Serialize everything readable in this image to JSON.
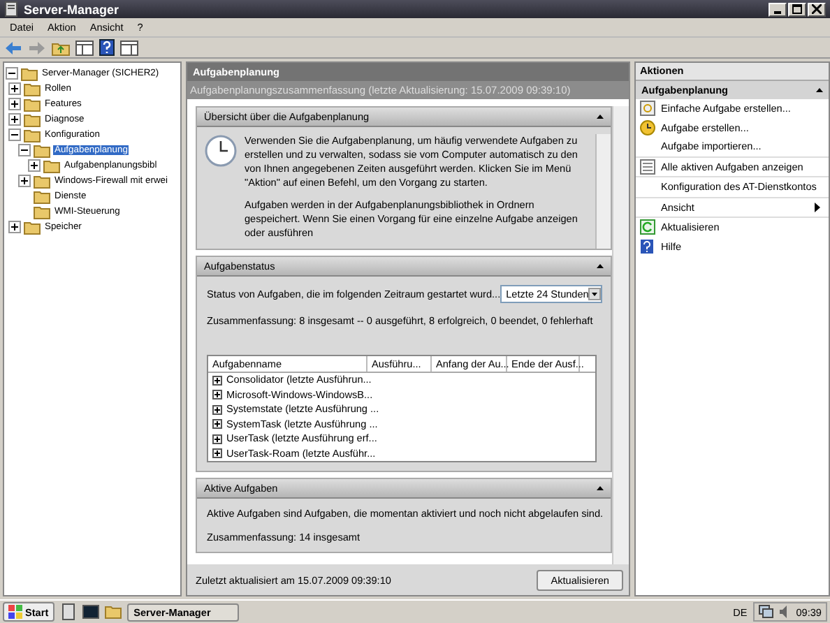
{
  "window": {
    "title": "Server-Manager"
  },
  "menu": [
    "Datei",
    "Aktion",
    "Ansicht",
    "?"
  ],
  "tree": [
    {
      "label": "Server-Manager (SICHER2)",
      "expanded": true,
      "selected": false,
      "children": [
        {
          "label": "Rollen",
          "expanded": false,
          "selected": false
        },
        {
          "label": "Features",
          "expanded": false,
          "selected": false
        },
        {
          "label": "Diagnose",
          "expanded": false,
          "selected": false
        },
        {
          "label": "Konfiguration",
          "expanded": true,
          "selected": false,
          "children": [
            {
              "label": "Aufgabenplanung",
              "expanded": true,
              "selected": true,
              "children": [
                {
                  "label": "Aufgabenplanungsbibl",
                  "expanded": false,
                  "selected": false
                }
              ]
            },
            {
              "label": "Windows-Firewall mit erwei",
              "expanded": false,
              "selected": false
            },
            {
              "label": "Dienste",
              "leaf": true,
              "selected": false
            },
            {
              "label": "WMI-Steuerung",
              "leaf": true,
              "selected": false
            }
          ]
        },
        {
          "label": "Speicher",
          "expanded": false,
          "selected": false
        }
      ]
    }
  ],
  "center": {
    "title": "Aufgabenplanung",
    "summary_bar": "Aufgabenplanungszusammenfassung (letzte Aktualisierung: 15.07.2009 09:39:10)",
    "overview": {
      "title": "Übersicht über die Aufgabenplanung",
      "paragraphs": [
        "Verwenden Sie die Aufgabenplanung, um häufig verwendete Aufgaben zu erstellen und zu verwalten, sodass sie vom Computer automatisch zu den von Ihnen angegebenen Zeiten ausgeführt werden. Klicken Sie im Menü \"Aktion\" auf einen Befehl, um den Vorgang zu starten.",
        "Aufgaben werden in der Aufgabenplanungsbibliothek in Ordnern gespeichert. Wenn Sie einen Vorgang für eine einzelne Aufgabe anzeigen oder ausführen"
      ]
    },
    "status": {
      "title": "Aufgabenstatus",
      "filter_label": "Status von Aufgaben, die im folgenden Zeitraum gestartet wurd...",
      "filter_value": "Letzte 24 Stunden",
      "summary": "Zusammenfassung: 8 insgesamt -- 0 ausgeführt, 8 erfolgreich, 0 beendet, 0 fehlerhaft",
      "columns": [
        "Aufgabenname",
        "Ausführu...",
        "Anfang der Au...",
        "Ende der Ausf..."
      ],
      "rows": [
        "Consolidator (letzte Ausführun...",
        "Microsoft-Windows-WindowsB...",
        "Systemstate (letzte Ausführung ...",
        "SystemTask (letzte Ausführung ...",
        "UserTask (letzte Ausführung erf...",
        "UserTask-Roam (letzte Ausführ..."
      ]
    },
    "active": {
      "title": "Aktive Aufgaben",
      "text": "Aktive Aufgaben sind Aufgaben, die momentan aktiviert und noch nicht abgelaufen sind.",
      "summary": "Zusammenfassung: 14 insgesamt"
    },
    "footer": "Zuletzt aktualisiert am 15.07.2009 09:39:10",
    "refresh_button": "Aktualisieren"
  },
  "actions": {
    "title": "Aktionen",
    "group": "Aufgabenplanung",
    "items": [
      {
        "label": "Einfache Aufgabe erstellen...",
        "kind": "wizard"
      },
      {
        "label": "Aufgabe erstellen...",
        "kind": "task"
      },
      {
        "label": "Aufgabe importieren...",
        "kind": "plain"
      },
      {
        "label": "Alle aktiven Aufgaben anzeigen",
        "kind": "list"
      },
      {
        "label": "Konfiguration des AT-Dienstkontos",
        "kind": "plain"
      },
      {
        "label": "Ansicht",
        "kind": "submenu"
      },
      {
        "label": "Aktualisieren",
        "kind": "refresh"
      },
      {
        "label": "Hilfe",
        "kind": "help"
      }
    ]
  },
  "taskbar": {
    "start": "Start",
    "task": "Server-Manager",
    "language": "DE",
    "clock": "09:39"
  }
}
